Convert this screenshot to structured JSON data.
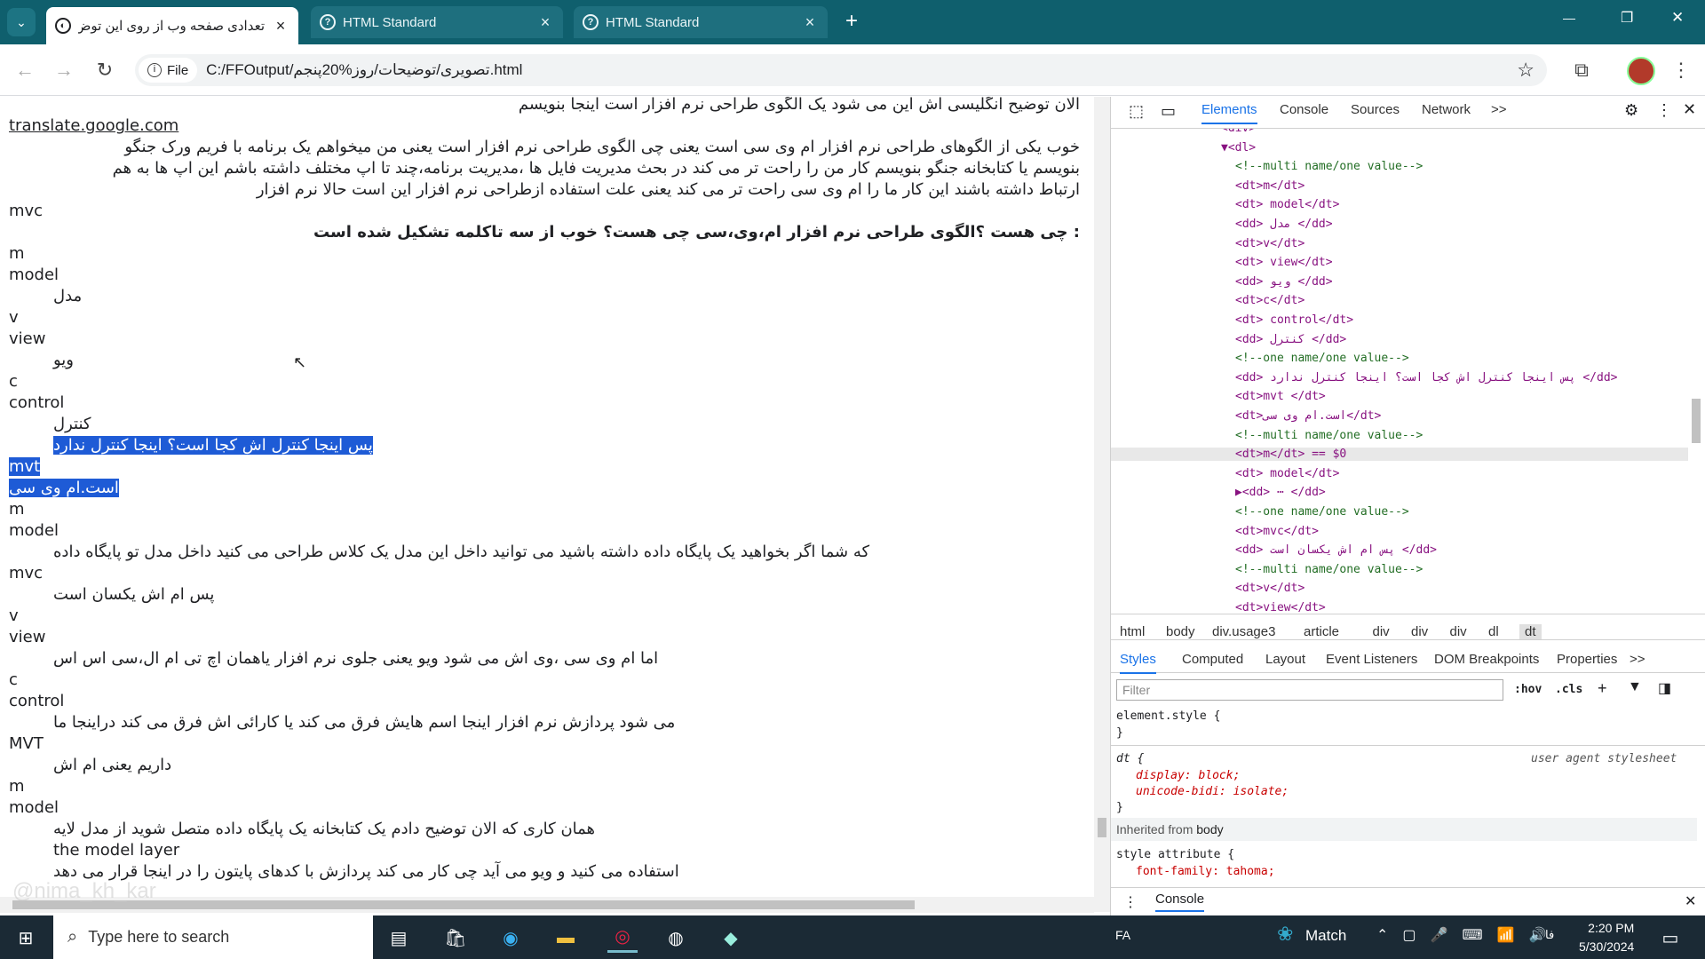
{
  "browser": {
    "tabs": [
      {
        "title": "تعدادی صفحه وب از روی این توض",
        "close": "×"
      },
      {
        "title": "HTML Standard",
        "close": "×"
      },
      {
        "title": "HTML Standard",
        "close": "×"
      }
    ],
    "new_tab": "+",
    "window": {
      "minimize": "—",
      "restore": "❐",
      "close": "✕"
    },
    "file_chip": "File",
    "url": "C:/FFOutput/تصویری/توضیحات/روز%20پنجم.html"
  },
  "page": {
    "lines": [
      {
        "t": "الان توضیح انگلیسی اش این می شود یک الگوی طراحی نرم افزار است اینجا بنویسم",
        "c": "rtl"
      },
      {
        "t": "translate.google.com",
        "c": "link"
      },
      {
        "t": "خوب یکی از الگوهای طراحی نرم افزار ام وی سی است یعنی چی الگوی طراحی نرم افزار است یعنی من میخواهم یک برنامه با فریم ورک جنگو",
        "c": "rtl"
      },
      {
        "t": "بنویسم یا کتابخانه جنگو بنویسم کار من را راحت تر می کند در بحث مدیریت فایل ها ،مدیریت برنامه،چند تا اپ مختلف داشته باشم این اپ ها به هم",
        "c": "rtl"
      },
      {
        "t": "ارتباط داشته باشند این کار ما را ام وی سی راحت تر می کند یعنی علت استفاده ازطراحی نرم افزار این است حالا نرم افزار",
        "c": "rtl"
      },
      {
        "t": "mvc",
        "c": ""
      },
      {
        "t": ": چی هست ؟الگوی طراحی نرم افزار ام،وی،سی چی هست؟ خوب از سه تاکلمه تشکیل شده است",
        "c": "rtl bold"
      },
      {
        "t": "m",
        "c": ""
      },
      {
        "t": "model",
        "c": ""
      },
      {
        "t": "مدل",
        "c": "dd"
      },
      {
        "t": "v",
        "c": ""
      },
      {
        "t": "view",
        "c": ""
      },
      {
        "t": "ویو",
        "c": "dd"
      },
      {
        "t": "c",
        "c": ""
      },
      {
        "t": "control",
        "c": ""
      },
      {
        "t": "کنترل",
        "c": "dd"
      },
      {
        "t": "پس اینجا کنترل اش کجا است؟ اینجا کنترل ندارد",
        "c": "dd sel"
      },
      {
        "t": "mvt",
        "c": "sel"
      },
      {
        "t": "است.ام وی سی",
        "c": "sel"
      },
      {
        "t": "m",
        "c": ""
      },
      {
        "t": "model",
        "c": ""
      },
      {
        "t": "که شما اگر بخواهید یک پایگاه داده داشته باشید می توانید داخل این مدل یک کلاس طراحی می کنید داخل مدل تو پایگاه داده",
        "c": "dd"
      },
      {
        "t": "mvc",
        "c": ""
      },
      {
        "t": "پس ام اش یکسان است",
        "c": "dd"
      },
      {
        "t": "v",
        "c": ""
      },
      {
        "t": "view",
        "c": ""
      },
      {
        "t": "اما ام وی سی ،وی اش می شود ویو یعنی جلوی نرم افزار یاهمان اچ تی ام ال،سی اس اس",
        "c": "dd"
      },
      {
        "t": "c",
        "c": ""
      },
      {
        "t": "control",
        "c": ""
      },
      {
        "t": "می شود پردازش نرم افزار اینجا اسم هایش فرق می کند یا کارائی اش فرق می کند دراینجا ما",
        "c": "dd"
      },
      {
        "t": "MVT",
        "c": ""
      },
      {
        "t": "داریم یعنی ام اش",
        "c": "dd"
      },
      {
        "t": "m",
        "c": ""
      },
      {
        "t": "model",
        "c": ""
      },
      {
        "t": "همان کاری که الان توضیح دادم یک کتابخانه یک پایگاه داده متصل شوید از مدل لایه",
        "c": "dd"
      },
      {
        "t": "the model layer",
        "c": "dd"
      },
      {
        "t": "استفاده می کنید و ویو می آید چی کار می کند پردازش با کدهای پایتون را در اینجا قرار می دهد",
        "c": "dd"
      }
    ],
    "watermark": "@nima_kh_kar"
  },
  "devtools": {
    "tabs": [
      "Elements",
      "Console",
      "Sources",
      "Network",
      ">>"
    ],
    "dom": [
      {
        "t": "<div>",
        "c": "",
        "i": 0
      },
      {
        "t": "▼<dl>",
        "c": "",
        "i": 0
      },
      {
        "t": "<!--multi name/one value-->",
        "c": "cmt",
        "i": 1
      },
      {
        "t": "<dt>m</dt>",
        "c": "",
        "i": 1
      },
      {
        "t": "<dt> model</dt>",
        "c": "",
        "i": 1
      },
      {
        "t": "<dd> مدل </dd>",
        "c": "",
        "i": 1
      },
      {
        "t": "<dt>v</dt>",
        "c": "",
        "i": 1
      },
      {
        "t": "<dt> view</dt>",
        "c": "",
        "i": 1
      },
      {
        "t": "<dd> ویو </dd>",
        "c": "",
        "i": 1
      },
      {
        "t": "<dt>c</dt>",
        "c": "",
        "i": 1
      },
      {
        "t": "<dt> control</dt>",
        "c": "",
        "i": 1
      },
      {
        "t": "<dd> کنترل </dd>",
        "c": "",
        "i": 1
      },
      {
        "t": "<!--one name/one value-->",
        "c": "cmt",
        "i": 1
      },
      {
        "t": "<dd> پس اینجا کنترل اش کجا است؟ اینجا کنترل ندارد </dd>",
        "c": "",
        "i": 1
      },
      {
        "t": "<dt>mvt </dt>",
        "c": "",
        "i": 1
      },
      {
        "t": "<dt>است.ام وی سی</dt>",
        "c": "",
        "i": 1
      },
      {
        "t": "<!--multi name/one value-->",
        "c": "cmt",
        "i": 1
      },
      {
        "t": "<dt>m</dt> == $0",
        "c": "hl",
        "i": 1
      },
      {
        "t": "<dt> model</dt>",
        "c": "",
        "i": 1
      },
      {
        "t": "▶<dd> ⋯ </dd>",
        "c": "",
        "i": 1
      },
      {
        "t": "<!--one name/one value-->",
        "c": "cmt",
        "i": 1
      },
      {
        "t": "<dt>mvc</dt>",
        "c": "",
        "i": 1
      },
      {
        "t": "<dd> پس ام اش یکسان است </dd>",
        "c": "",
        "i": 1
      },
      {
        "t": "<!--multi name/one value-->",
        "c": "cmt",
        "i": 1
      },
      {
        "t": "<dt>v</dt>",
        "c": "",
        "i": 1
      },
      {
        "t": "<dt>view</dt>",
        "c": "",
        "i": 1
      }
    ],
    "breadcrumbs": [
      "html",
      "body",
      "div.usage3",
      "article",
      "div",
      "div",
      "div",
      "dl",
      "dt"
    ],
    "style_tabs": [
      "Styles",
      "Computed",
      "Layout",
      "Event Listeners",
      "DOM Breakpoints",
      "Properties",
      ">>"
    ],
    "filter_placeholder": "Filter",
    "hov": ":hov",
    "cls": ".cls",
    "styles": {
      "element_style": "element.style {",
      "close": "}",
      "dt_sel": "dt {",
      "ua": "user agent stylesheet",
      "p1": "display: block;",
      "p2": "unicode-bidi: isolate;",
      "inherited_label": "Inherited from",
      "inherited_from": "body",
      "style_attr": "style attribute {",
      "font": "font-family: tahoma;"
    },
    "drawer": "Console"
  },
  "taskbar": {
    "search_placeholder": "Type here to search",
    "lang": "FA",
    "match": "Match",
    "time": "2:20 PM",
    "date": "5/30/2024"
  }
}
